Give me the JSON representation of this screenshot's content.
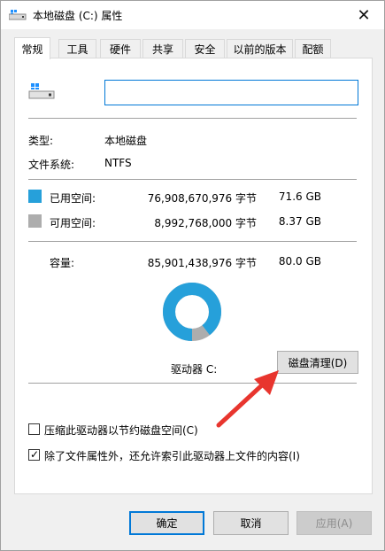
{
  "window": {
    "title": "本地磁盘 (C:) 属性"
  },
  "tabs": [
    {
      "label": "常规",
      "active": true
    },
    {
      "label": "工具"
    },
    {
      "label": "硬件"
    },
    {
      "label": "共享"
    },
    {
      "label": "安全"
    },
    {
      "label": "以前的版本"
    },
    {
      "label": "配额"
    }
  ],
  "general": {
    "name_value": "",
    "type_label": "类型:",
    "type_value": "本地磁盘",
    "fs_label": "文件系统:",
    "fs_value": "NTFS",
    "used_label": "已用空间:",
    "used_bytes": "76,908,670,976 字节",
    "used_size": "71.6 GB",
    "free_label": "可用空间:",
    "free_bytes": "8,992,768,000 字节",
    "free_size": "8.37 GB",
    "capacity_label": "容量:",
    "capacity_bytes": "85,901,438,976 字节",
    "capacity_size": "80.0 GB",
    "drive_label": "驱动器 C:",
    "cleanup_button": "磁盘清理(D)",
    "used_fraction": 0.895,
    "compress_label": "压缩此驱动器以节约磁盘空间(C)",
    "compress_checked": false,
    "index_label": "除了文件属性外，还允许索引此驱动器上文件的内容(I)",
    "index_checked": true
  },
  "colors": {
    "used": "#26a0da",
    "free": "#adadad",
    "accent": "#0078d7",
    "arrow": "#e8352e"
  },
  "buttons": {
    "ok": "确定",
    "cancel": "取消",
    "apply": "应用(A)"
  }
}
